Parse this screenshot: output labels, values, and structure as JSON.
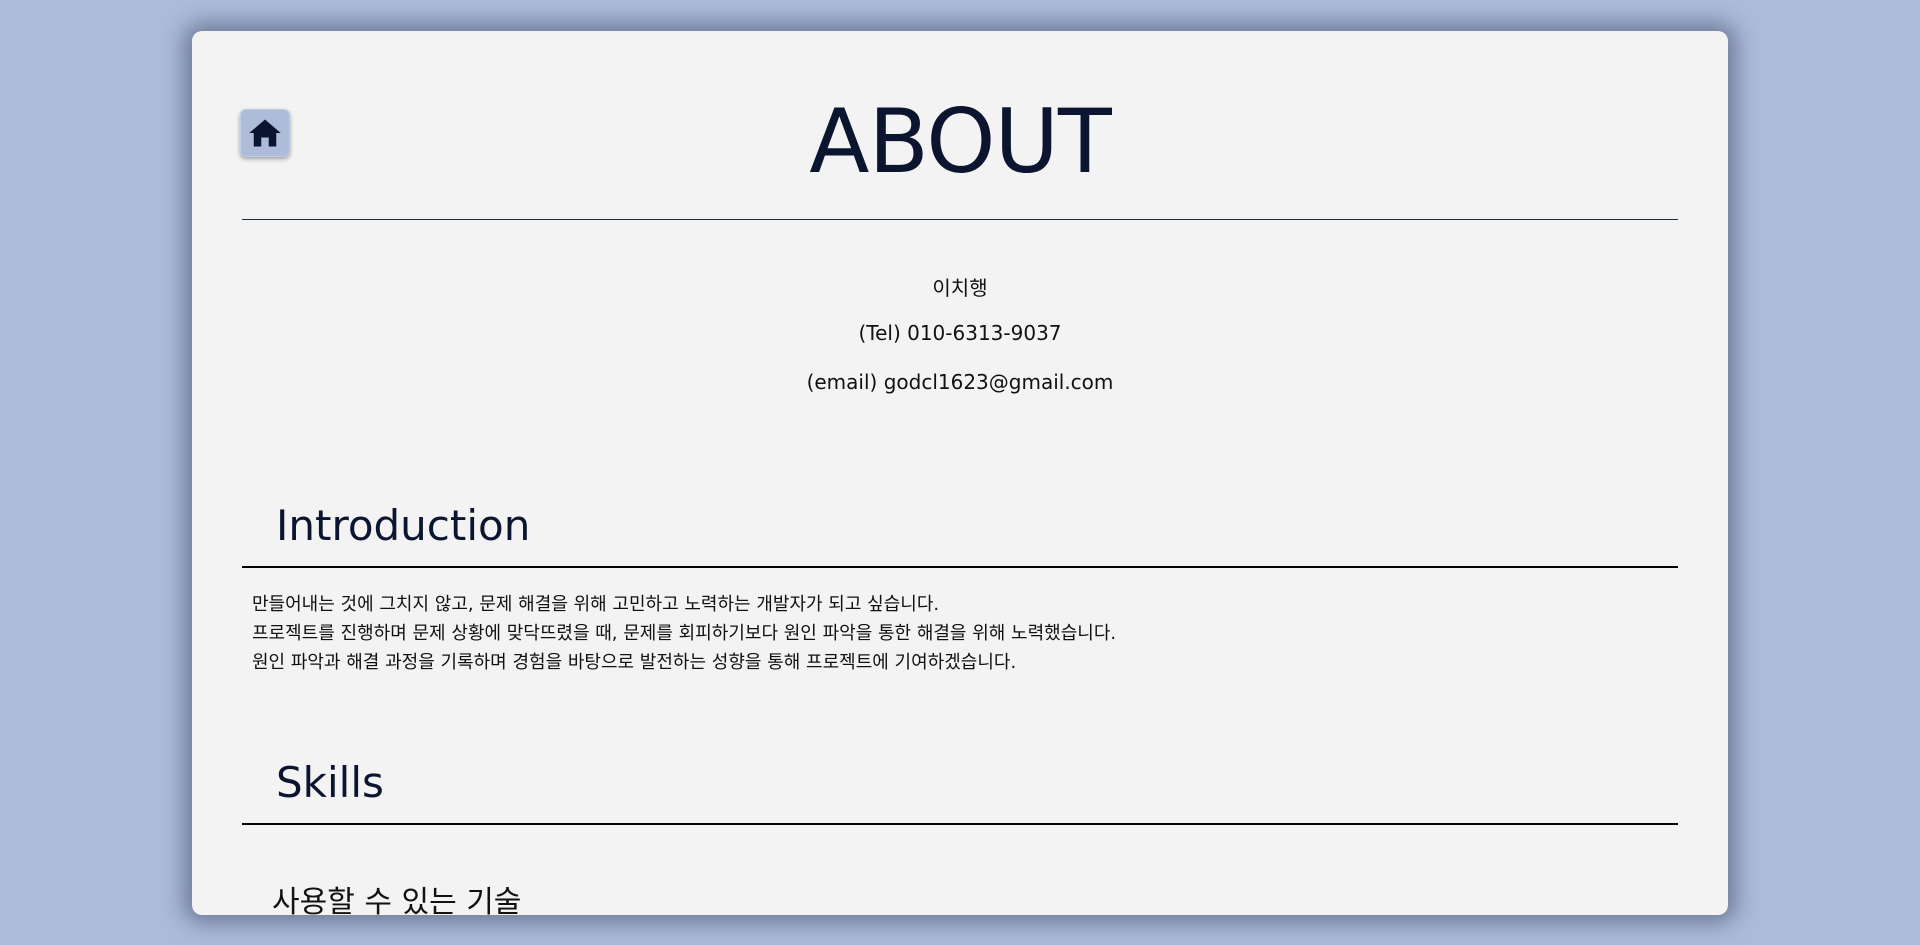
{
  "header": {
    "title": "ABOUT",
    "home_icon": "home-icon"
  },
  "contact": {
    "name": "이치행",
    "tel": "(Tel) 010-6313-9037",
    "email": "(email) godcl1623@gmail.com"
  },
  "introduction": {
    "heading": "Introduction",
    "lines": [
      "만들어내는 것에 그치지 않고, 문제 해결을 위해 고민하고 노력하는 개발자가 되고 싶습니다.",
      "프로젝트를 진행하며 문제 상황에 맞닥뜨렸을 때, 문제를 회피하기보다 원인 파악을 통한 해결을 위해 노력했습니다.",
      "원인 파악과 해결 과정을 기록하며 경험을 바탕으로 발전하는 성향을 통해 프로젝트에 기여하겠습니다."
    ]
  },
  "skills": {
    "heading": "Skills",
    "subheading": "사용할 수 있는 기술"
  },
  "colors": {
    "background": "#abbbd9",
    "card": "#f3f3f3",
    "title": "#0c1530"
  }
}
